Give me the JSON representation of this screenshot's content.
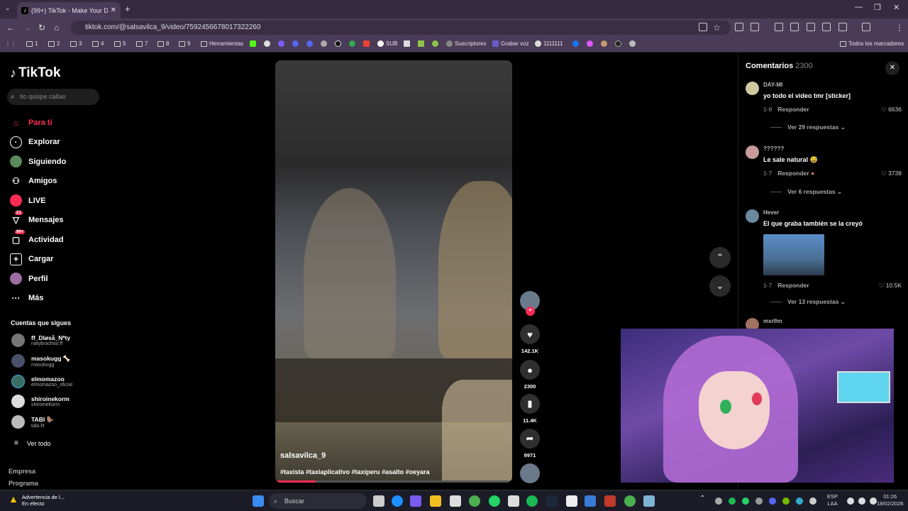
{
  "browser": {
    "tab_title": "(99+) TikTok - Make Your Da",
    "url": "tiktok.com/@salsavilca_9/video/7592456678017322260",
    "bookmarks": [
      "1",
      "2",
      "3",
      "4",
      "5",
      "7",
      "8",
      "9",
      "Herramientas",
      "SUB",
      "Suscriptores",
      "Grabar voz",
      "1111111"
    ],
    "all_bookmarks": "Todos los marcadores"
  },
  "sidebar": {
    "logo": "TikTok",
    "search_placeholder": "tio quispe callao",
    "nav": [
      {
        "label": "Para ti",
        "icon": "home-icon"
      },
      {
        "label": "Explorar",
        "icon": "compass-icon"
      },
      {
        "label": "Siguiendo",
        "icon": "following-icon"
      },
      {
        "label": "Amigos",
        "icon": "friends-icon"
      },
      {
        "label": "LIVE",
        "icon": "live-icon"
      },
      {
        "label": "Mensajes",
        "icon": "messages-icon",
        "badge": "21"
      },
      {
        "label": "Actividad",
        "icon": "activity-icon",
        "badge": "99+"
      },
      {
        "label": "Cargar",
        "icon": "upload-icon"
      },
      {
        "label": "Perfil",
        "icon": "profile-icon"
      },
      {
        "label": "Más",
        "icon": "more-icon"
      }
    ],
    "following_title": "Cuentas que sigues",
    "following": [
      {
        "name": "ff_Dløså_Nªty",
        "user": "natybrachoo.ff"
      },
      {
        "name": "masokugg 🦴",
        "user": "masokugg"
      },
      {
        "name": "elmomazoo",
        "user": "elmomazoo_oficial"
      },
      {
        "name": "shiroinekorm",
        "user": "shiroinekorm"
      },
      {
        "name": "TABI 🦫",
        "user": "tabi.fit"
      }
    ],
    "see_all": "Ver todo",
    "footer": [
      "Empresa",
      "Programa"
    ]
  },
  "video": {
    "username": "salsavilca_9",
    "hashtags": "#taxista #taxiaplicativo #taxiperu #asalto #oeyara",
    "progress": 0.17
  },
  "actions": {
    "likes": "142.1K",
    "comments": "2300",
    "saves": "11.4K",
    "shares": "9971"
  },
  "comments": {
    "title": "Comentarios",
    "count": "2300",
    "items": [
      {
        "user": "DAY-MI",
        "text": "yo todo el video tmr [sticker]",
        "date": "1-8",
        "reply": "Responder",
        "likes": "6636",
        "more": "Ver 29 respuestas"
      },
      {
        "user": "??????",
        "text": "Le sale natural 😅",
        "date": "1-7",
        "reply": "Responder",
        "likes": "3738",
        "more": "Ver 6 respuestas"
      },
      {
        "user": "Hever",
        "text": "El que graba también se la creyó",
        "date": "1-7",
        "reply": "Responder",
        "likes": "10.5K",
        "more": "Ver 13 respuestas"
      },
      {
        "user": "mxrlhn"
      }
    ]
  },
  "taskbar": {
    "warning_title": "Advertencia de l...",
    "warning_sub": "En efecto",
    "search": "Buscar",
    "lang": "ESP",
    "lang2": "LAA",
    "time": "01:26",
    "date": "18/02/2026"
  }
}
